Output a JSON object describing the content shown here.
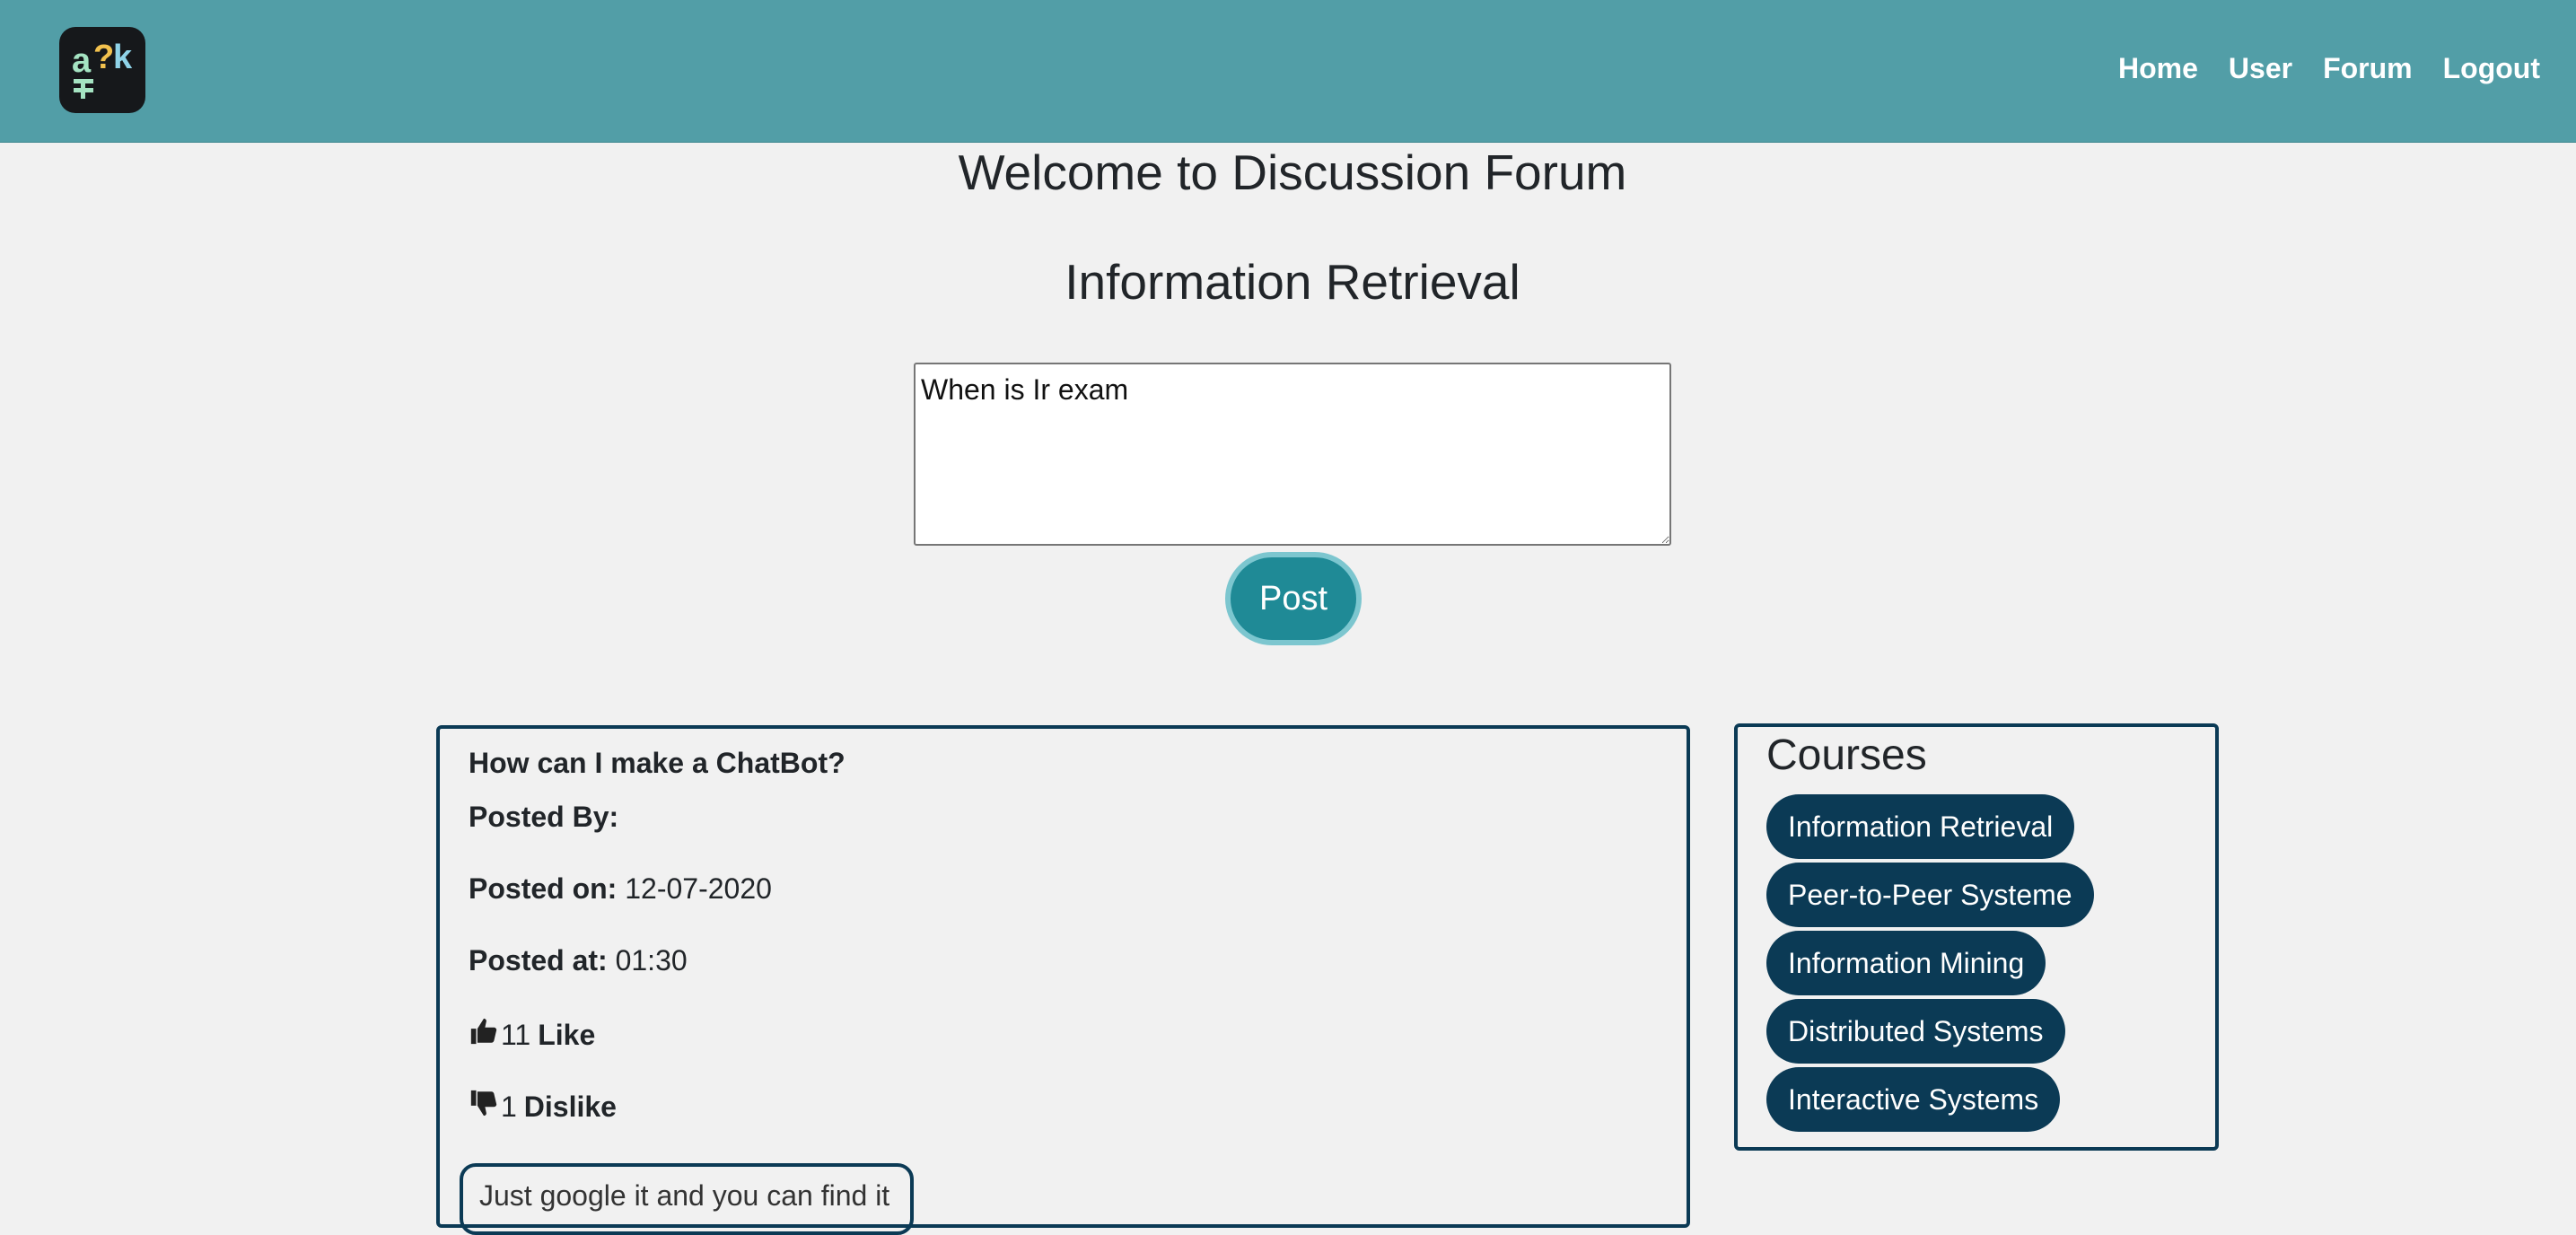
{
  "header": {
    "logo_text": "a?k",
    "nav": [
      "Home",
      "User",
      "Forum",
      "Logout"
    ]
  },
  "page": {
    "title": "Welcome to Discussion Forum",
    "subtitle": "Information Retrieval"
  },
  "composer": {
    "textarea_value": "When is Ir exam",
    "post_label": "Post"
  },
  "post": {
    "question": "How can I make a ChatBot?",
    "posted_by_label": "Posted By:",
    "posted_by_value": "",
    "posted_on_label": "Posted on:",
    "posted_on_value": "12-07-2020",
    "posted_at_label": "Posted at:",
    "posted_at_value": "01:30",
    "like_count": "11",
    "like_label": "Like",
    "dislike_count": "1",
    "dislike_label": "Dislike",
    "reply_text": "Just google it and you can find it"
  },
  "courses": {
    "heading": "Courses",
    "items": [
      "Information Retrieval",
      "Peer-to-Peer Systeme",
      "Information Mining",
      "Distributed Systems",
      "Interactive Systems"
    ]
  },
  "colors": {
    "header_bg": "#529ea7",
    "post_button": "#1f8a96",
    "pill_bg": "#0b3a55",
    "page_bg": "#f1f1f1"
  },
  "icons": {
    "logo": "app-logo-icon",
    "like": "thumbs-up-icon",
    "dislike": "thumbs-down-icon"
  }
}
